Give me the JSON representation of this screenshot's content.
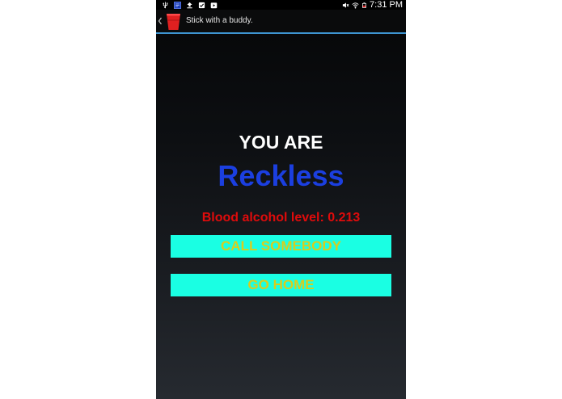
{
  "status_bar": {
    "time": "7:31 PM",
    "left_icons": [
      "usb-icon",
      "app-notification-icon",
      "upload-icon",
      "checklist-icon",
      "play-store-icon"
    ],
    "right_icons": [
      "mute-icon",
      "wifi-icon",
      "battery-icon"
    ]
  },
  "action_bar": {
    "title": "Stick with a buddy.",
    "cup_color": "#e02020",
    "underline_color": "#3d94d1"
  },
  "main": {
    "heading": "YOU ARE",
    "status_word": "Reckless",
    "status_color": "#1b3fe0",
    "bac_text": "Blood alcohol level: 0.213",
    "bac_color": "#e00b0b",
    "buttons": {
      "call_label": "CALL SOMEBODY",
      "home_label": "GO HOME"
    },
    "button_bg": "#1affe3",
    "button_text_color": "#d8cd1e"
  }
}
